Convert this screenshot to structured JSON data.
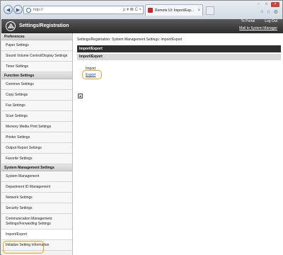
{
  "browser": {
    "url": "http://",
    "tab_label": "Remote UI: Import/Exp...",
    "tab_close": "×",
    "back_icon": "back-arrow-icon",
    "forward_icon": "forward-arrow-icon",
    "address_tools": "ρ ▾ ⊠ C ×",
    "window_controls": {
      "minimize": "–",
      "maximize": "□",
      "close": "×"
    },
    "toolbar_icons": [
      "home-icon",
      "star-icon",
      "gear-icon"
    ]
  },
  "header": {
    "title": "Settings/Registration",
    "links": {
      "portal": "To Portal",
      "logout": "Log Out",
      "mail": "Mail to System Manager"
    }
  },
  "sidebar": {
    "sections": [
      {
        "title": "Preferences",
        "items": [
          "Paper Settings",
          "Sound Volume Control/Display Settings",
          "Timer Settings"
        ]
      },
      {
        "title": "Function Settings",
        "items": [
          "Common Settings",
          "Copy Settings",
          "Fax Settings",
          "Scan Settings",
          "Memory Media Print Settings",
          "Printer Settings",
          "Output Report Settings",
          "Favorite Settings"
        ]
      },
      {
        "title": "System Management Settings",
        "items": [
          "System Management",
          "Department ID Management",
          "Network Settings",
          "Security Settings",
          "Communication Management Settings/Forwarding Settings",
          "Import/Export",
          "Initialize Setting Information"
        ]
      }
    ]
  },
  "content": {
    "breadcrumb": "Settings/Registration: System Management Settings: Import/Export",
    "panel_title": "Import/Export",
    "section_title": "Import/Export",
    "import_label": "Import",
    "export_label": "Export",
    "top_icon": "page-top-icon"
  },
  "colors": {
    "highlight": "#f2a213",
    "header_dark": "#2b2b2b",
    "link": "#1a3fb0"
  }
}
